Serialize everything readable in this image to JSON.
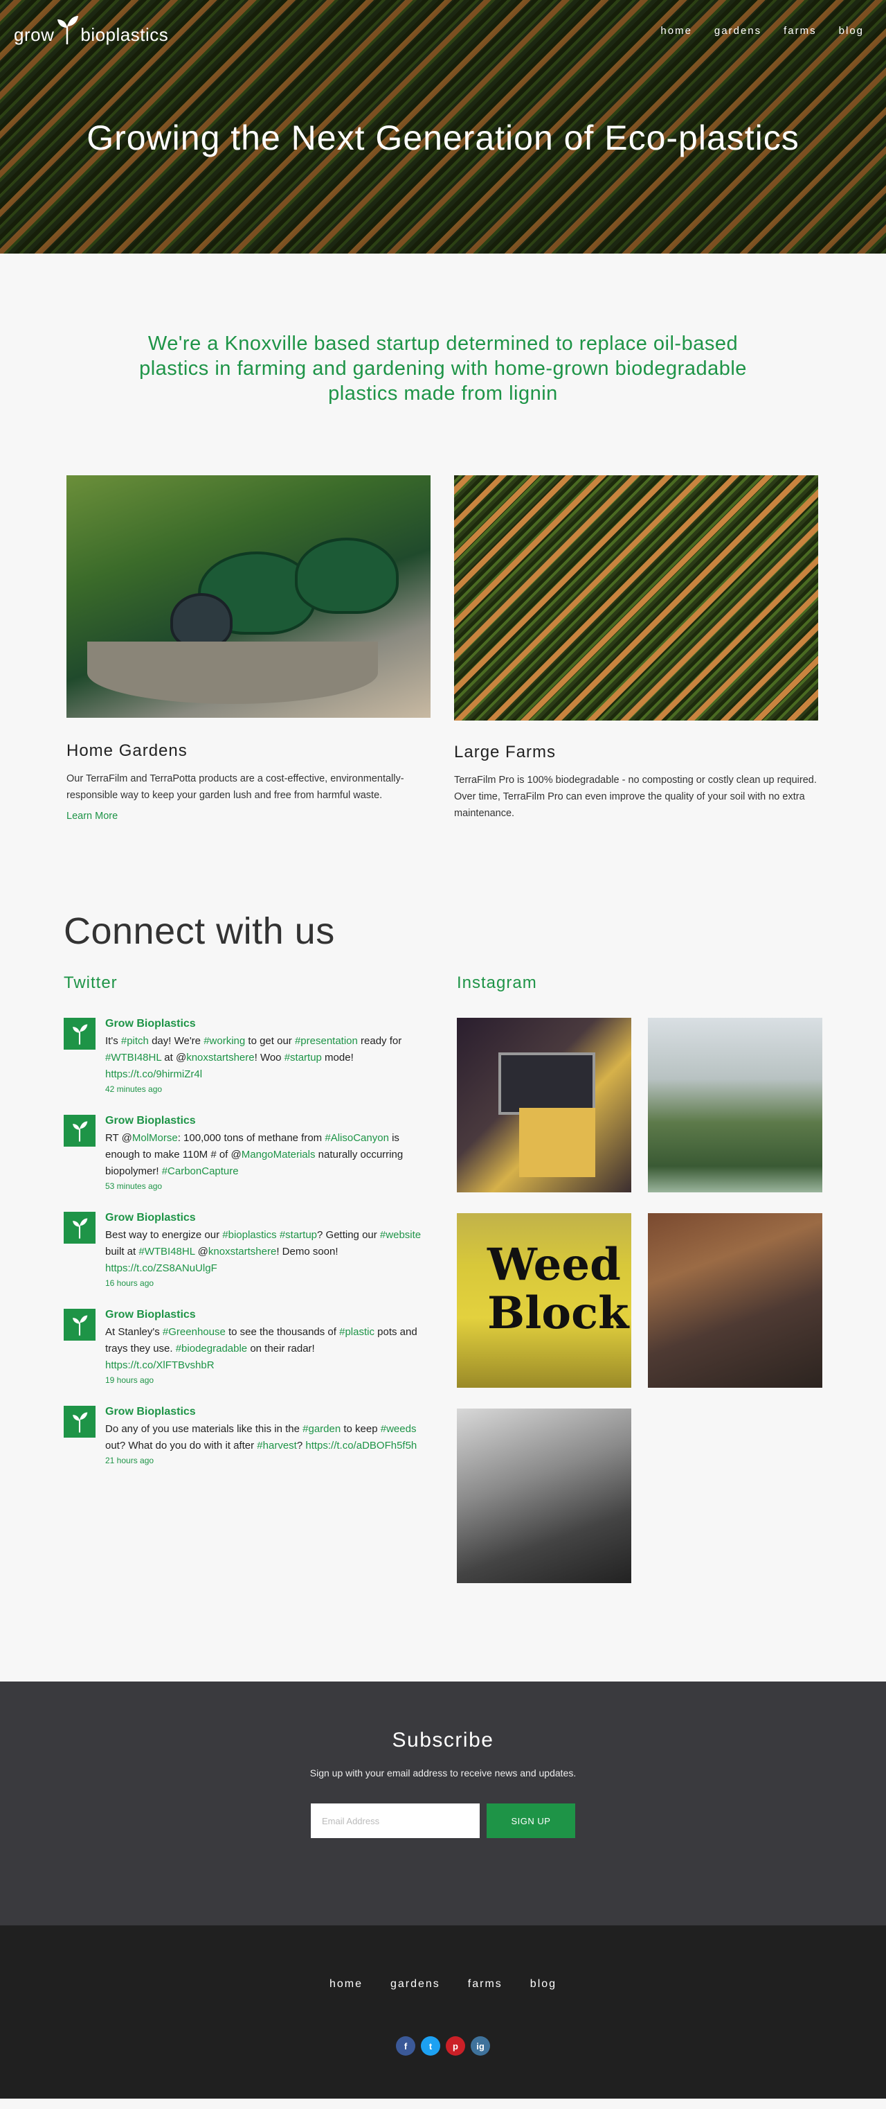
{
  "brand": {
    "logo_text_left": "grow",
    "logo_text_right": "bioplastics"
  },
  "nav": [
    "home",
    "gardens",
    "farms",
    "blog"
  ],
  "hero": {
    "title": "Growing the Next Generation of Eco-plastics"
  },
  "intro": {
    "text": "We're a Knoxville based startup determined to replace oil-based plastics in farming and gardening with home-grown biodegradable plastics made from lignin"
  },
  "products": [
    {
      "title": "Home Gardens",
      "text": "Our TerraFilm and TerraPotta products are a cost-effective, environmentally-responsible way to keep your garden lush and free from harmful waste.",
      "link": "Learn More"
    },
    {
      "title": "Large Farms",
      "text": "TerraFilm Pro is 100% biodegradable - no composting or costly clean up required. Over time, TerraFilm Pro can even improve the quality of your soil with no extra maintenance."
    }
  ],
  "connect": {
    "heading": "Connect with us",
    "twitter_heading": "Twitter",
    "instagram_heading": "Instagram"
  },
  "tweets": [
    {
      "name": "Grow Bioplastics",
      "html": "It's <span class=\"g\">#pitch</span> day! We're <span class=\"g\">#working</span> to get our <span class=\"g\">#presentation</span> ready for <span class=\"g\">#WTBI48HL</span> at @<span class=\"g\">knoxstartshere</span>! Woo <span class=\"g\">#startup</span> mode! <span class=\"g\">https://t.co/9hirmiZr4l</span>",
      "time": "42 minutes ago"
    },
    {
      "name": "Grow Bioplastics",
      "html": "RT @<span class=\"g\">MolMorse</span>: 100,000 tons of methane from <span class=\"g\">#AlisoCanyon</span> is enough to make 110M # of @<span class=\"g\">MangoMaterials</span> naturally occurring biopolymer! <span class=\"g\">#CarbonCapture</span>",
      "time": "53 minutes ago"
    },
    {
      "name": "Grow Bioplastics",
      "html": "Best way to energize our <span class=\"g\">#bioplastics</span> <span class=\"g\">#startup</span>? Getting our <span class=\"g\">#website</span> built at <span class=\"g\">#WTBI48HL</span> @<span class=\"g\">knoxstartshere</span>! Demo soon! <span class=\"g\">https://t.co/ZS8ANuUlgF</span>",
      "time": "16 hours ago"
    },
    {
      "name": "Grow Bioplastics",
      "html": "At Stanley's <span class=\"g\">#Greenhouse</span> to see the thousands of <span class=\"g\">#plastic</span> pots and trays they use. <span class=\"g\">#biodegradable</span> on their radar! <span class=\"g\">https://t.co/XlFTBvshbR</span>",
      "time": "19 hours ago"
    },
    {
      "name": "Grow Bioplastics",
      "html": "Do any of you use materials like this in the <span class=\"g\">#garden</span> to keep <span class=\"g\">#weeds</span> out? What do you do with it after <span class=\"g\">#harvest</span>? <span class=\"g\">https://t.co/aDBOFh5f5h</span>",
      "time": "21 hours ago"
    }
  ],
  "instagram_label": "Weed Block",
  "subscribe": {
    "title": "Subscribe",
    "text": "Sign up with your email address to receive news and updates.",
    "placeholder": "Email Address",
    "button": "SIGN UP"
  },
  "footer_nav": [
    "home",
    "gardens",
    "farms",
    "blog"
  ],
  "social": {
    "facebook": "f",
    "twitter": "t",
    "pinterest": "p",
    "instagram": "ig"
  },
  "colors": {
    "accent": "#1e9447",
    "subscribe_bg": "#3a3a3e",
    "footer_bg": "#202020"
  }
}
